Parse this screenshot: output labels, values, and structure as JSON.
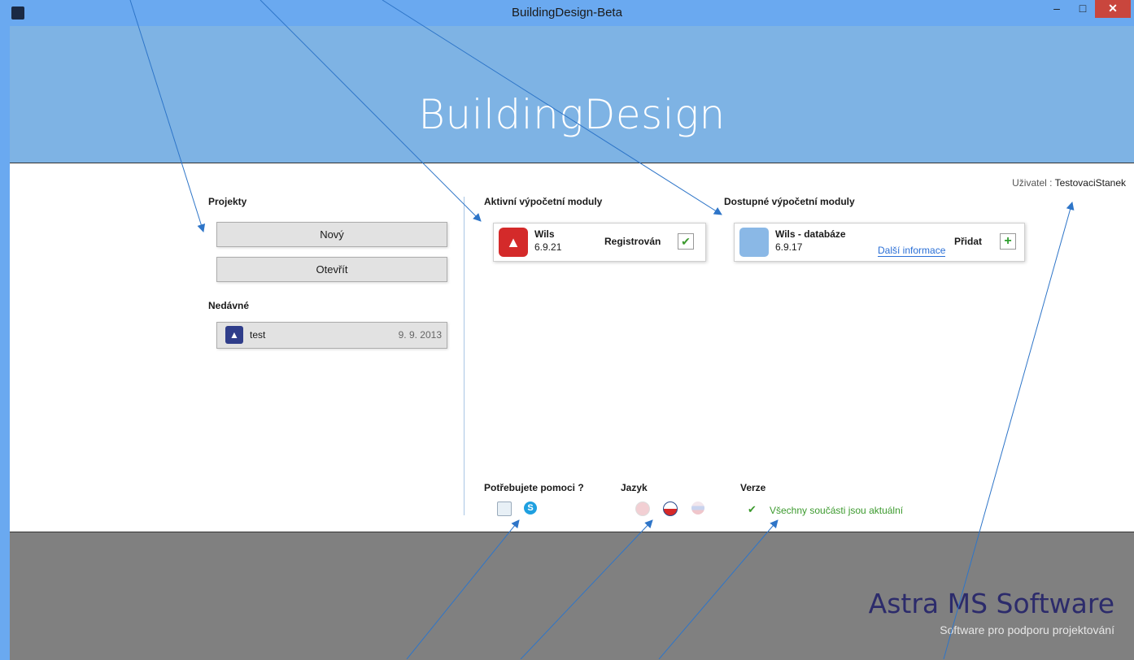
{
  "window": {
    "title": "BuildingDesign-Beta",
    "min": "–",
    "max": "□",
    "close": "✕"
  },
  "header": {
    "brand": "BuildingDesign"
  },
  "user": {
    "label": "Uživatel :",
    "name": "TestovaciStanek"
  },
  "projects": {
    "title": "Projekty",
    "new_label": "Nový",
    "open_label": "Otevřít"
  },
  "recent": {
    "title": "Nedávné",
    "items": [
      {
        "name": "test",
        "date": "9. 9. 2013"
      }
    ]
  },
  "active_modules": {
    "title": "Aktivní výpočetní moduly",
    "items": [
      {
        "name": "Wils",
        "version": "6.9.21",
        "status": "Registrován"
      }
    ]
  },
  "available_modules": {
    "title": "Dostupné výpočetní moduly",
    "items": [
      {
        "name": "Wils - databáze",
        "version": "6.9.17",
        "info_link": "Další informace",
        "add_label": "Přidat"
      }
    ]
  },
  "help": {
    "title": "Potřebujete pomoci ?"
  },
  "language": {
    "title": "Jazyk"
  },
  "version": {
    "title": "Verze",
    "status": "Všechny součásti jsou aktuální"
  },
  "footer": {
    "company": "Astra MS Software",
    "tagline": "Software pro podporu projektování"
  },
  "colors": {
    "titlebar": "#6aa9f0",
    "header_band": "#7eb3e4",
    "footer": "#808080",
    "accent_green": "#3c9a2e",
    "link": "#2a6fd6"
  }
}
